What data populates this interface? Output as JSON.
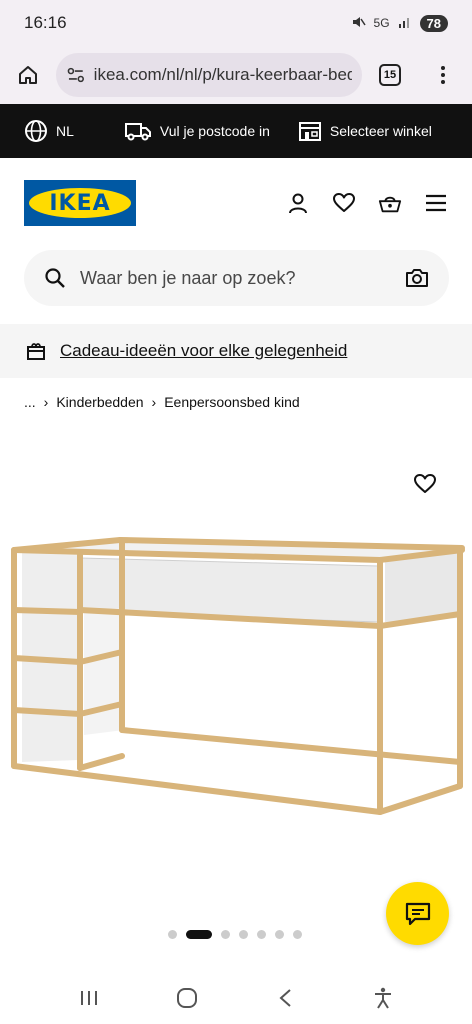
{
  "status_bar": {
    "time": "16:16",
    "network": "5G",
    "battery": "78"
  },
  "browser": {
    "url": "ikea.com/nl/nl/p/kura-keerbaar-bed",
    "tab_count": "15"
  },
  "top_bar": {
    "language": "NL",
    "postcode": "Vul je postcode in",
    "store": "Selecteer winkel"
  },
  "header": {
    "logo_text": "IKEA"
  },
  "search": {
    "placeholder": "Waar ben je naar op zoek?"
  },
  "promo": {
    "text": "Cadeau-ideeën voor elke gelegenheid"
  },
  "breadcrumb": {
    "ellipsis": "...",
    "items": [
      "Kinderbedden",
      "Eenpersoonsbed kind"
    ]
  },
  "carousel": {
    "total": 7,
    "active_index": 1
  },
  "colors": {
    "ikea_blue": "#0058a3",
    "ikea_yellow": "#ffdb00",
    "top_bar_bg": "#111111"
  },
  "icons": [
    "home-icon",
    "site-settings-icon",
    "tabs-icon",
    "more-vert-icon",
    "globe-icon",
    "truck-icon",
    "store-icon",
    "user-icon",
    "heart-icon",
    "basket-icon",
    "hamburger-icon",
    "search-icon",
    "camera-icon",
    "gift-icon",
    "chat-icon",
    "recents-icon",
    "home-circle-icon",
    "back-icon",
    "accessibility-icon"
  ]
}
